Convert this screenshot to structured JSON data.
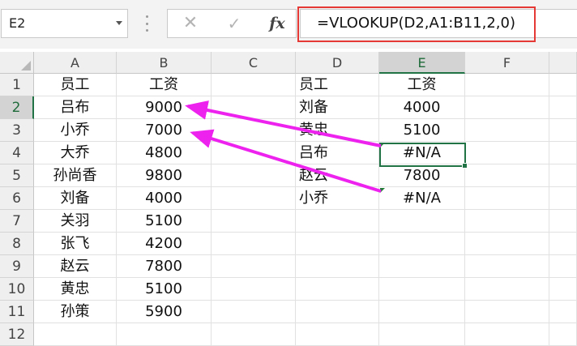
{
  "name_box": {
    "value": "E2"
  },
  "formula_bar": {
    "cancel_icon": "✕",
    "enter_icon": "✓",
    "fx_label": "fx",
    "formula": "=VLOOKUP(D2,A1:B11,2,0)",
    "highlight_color": "#e53935"
  },
  "columns": [
    "A",
    "B",
    "C",
    "D",
    "E",
    "F"
  ],
  "rows": [
    "1",
    "2",
    "3",
    "4",
    "5",
    "6",
    "7",
    "8",
    "9",
    "10",
    "11",
    "12"
  ],
  "cells": {
    "A": [
      "员工",
      "吕布",
      "小乔",
      "大乔",
      "孙尚香",
      "刘备",
      "关羽",
      "张飞",
      "赵云",
      "黄忠",
      "孙策",
      ""
    ],
    "B": [
      "工资",
      "9000",
      "7000",
      "4800",
      "9800",
      "4000",
      "5100",
      "4200",
      "7800",
      "5100",
      "5900",
      ""
    ],
    "D": [
      "员工",
      "刘备",
      "黄忠",
      "吕布",
      "赵云",
      "小乔",
      "",
      "",
      "",
      "",
      "",
      ""
    ],
    "E": [
      "工资",
      "4000",
      "5100",
      "#N/A",
      "7800",
      "#N/A",
      "",
      "",
      "",
      "",
      "",
      ""
    ]
  },
  "active": {
    "column": "E",
    "row": "2"
  },
  "colors": {
    "accent": "#217346",
    "arrow": "#ee22ee",
    "error_flag": "#1e7a34"
  }
}
